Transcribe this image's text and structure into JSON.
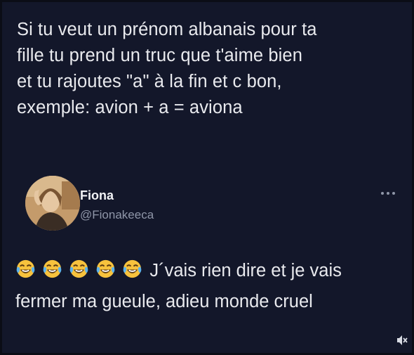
{
  "quoted_tweet": {
    "text": "Si tu veut un prénom albanais pour ta\nfille tu prend un truc que t'aime bien\net tu rajoutes \"a\" à la fin et c bon,\nexemple: avion + a = aviona"
  },
  "reply": {
    "author": {
      "name": "Fiona",
      "handle": "@Fionakeeca"
    },
    "emojis": [
      "face-with-tears-of-joy",
      "face-with-tears-of-joy",
      "face-with-tears-of-joy",
      "face-with-tears-of-joy",
      "face-with-tears-of-joy"
    ],
    "text": "J´vais rien dire et je vais fermer ma gueule, adieu monde cruel"
  },
  "icons": {
    "more": "more-horizontal-icon",
    "mute": "speaker-muted-icon"
  },
  "colors": {
    "background": "#13172a",
    "text": "#e9eaee",
    "handle": "#8f96a8"
  }
}
